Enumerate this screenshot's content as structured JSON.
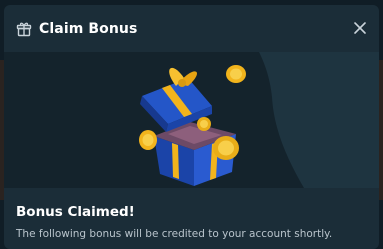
{
  "modal": {
    "title": "Claim Bonus",
    "header_icon": "gift-icon",
    "close_icon": "close-icon",
    "heading": "Bonus Claimed!",
    "message": "The following bonus will be credited to your account shortly."
  },
  "colors": {
    "modal_bg": "#1b2d38",
    "hero_bg": "#14232c",
    "box_blue": "#1f4bb8",
    "ribbon_gold": "#f2b41c"
  }
}
